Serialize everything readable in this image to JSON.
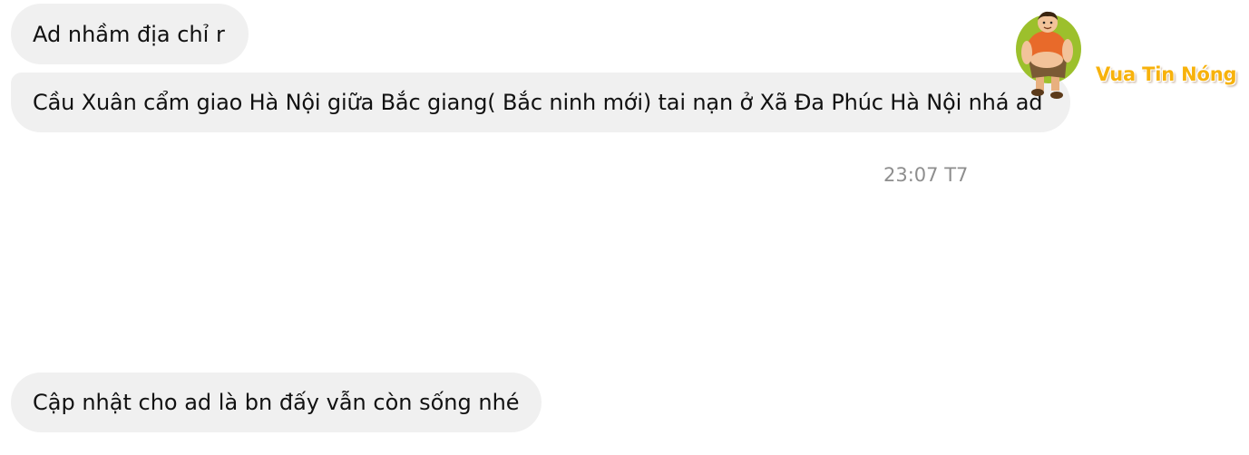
{
  "messages": [
    {
      "text": "Ad nhầm địa chỉ r"
    },
    {
      "text": "Cầu Xuân cẩm giao Hà Nội giữa Bắc giang( Bắc ninh mới) tai nạn ở Xã Đa Phúc Hà Nội nhá ad"
    },
    {
      "text": "Cập nhật cho ad là bn đấy vẫn còn sống nhé"
    }
  ],
  "timestamp": "23:07 T7",
  "watermark": {
    "text": "Vua Tin Nóng",
    "text_color": "#f7b20c",
    "icon": "cartoon-man-mascot"
  },
  "colors": {
    "bubble_bg": "#f0f0f0",
    "timestamp": "#8e8e8e"
  }
}
